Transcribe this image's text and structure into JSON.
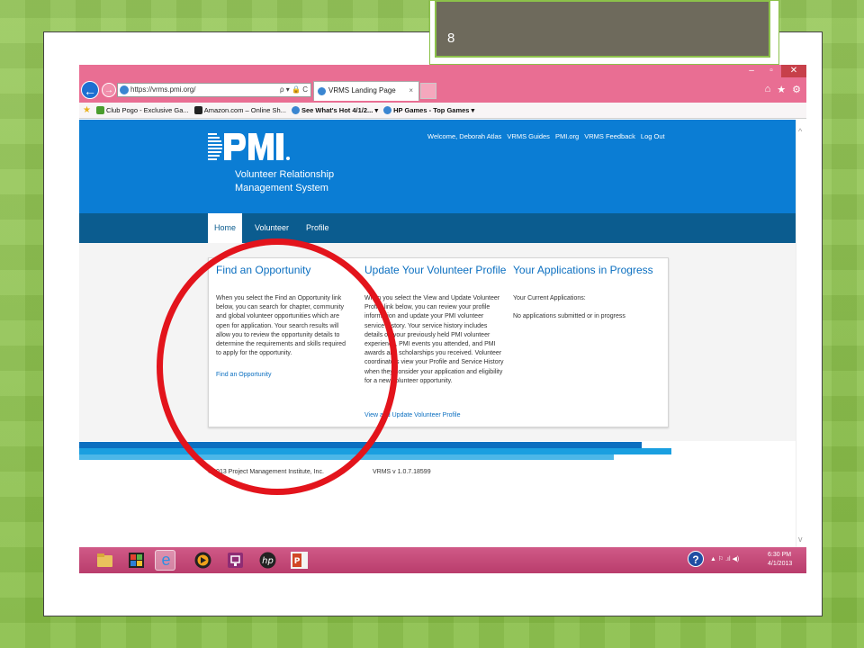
{
  "slide": {
    "number": "8"
  },
  "browser": {
    "url": "https://vrms.pmi.org/",
    "tab_title": "VRMS Landing Page",
    "tab_close": "×",
    "addr_tools": "ρ ▾ 🔒 C",
    "favorites": [
      {
        "label": "Club Pogo - Exclusive Ga...",
        "bold": false,
        "color": "#4a9d2e"
      },
      {
        "label": "Amazon.com – Online Sh...",
        "bold": false,
        "color": "#222222"
      },
      {
        "label": "See What's Hot 4/1/2... ▾",
        "bold": true,
        "color": "#3a86d1"
      },
      {
        "label": "HP Games - Top Games ▾",
        "bold": true,
        "color": "#3a86d1"
      }
    ],
    "window_controls": [
      "–",
      "▫",
      "✕"
    ],
    "nav_icons": [
      "⌂",
      "★",
      "⚙"
    ]
  },
  "header": {
    "logo_text": "PMI",
    "subtitle_line1": "Volunteer Relationship",
    "subtitle_line2": "Management System",
    "top_links": [
      "Welcome, Deborah Atlas",
      "VRMS Guides",
      "PMI.org",
      "VRMS Feedback",
      "Log Out"
    ]
  },
  "menu": {
    "items": [
      "Home",
      "Volunteer",
      "Profile"
    ],
    "active": "Home"
  },
  "panels": {
    "find": {
      "title": "Find an Opportunity",
      "text": "When you select the Find an Opportunity link below, you can search for chapter, community and global volunteer opportunities which are open for application. Your search results will allow you to review the opportunity details to determine the requirements and skills required to apply for the opportunity.",
      "link": "Find an Opportunity"
    },
    "update": {
      "title": "Update Your Volunteer Profile",
      "text": "When you select the View and Update Volunteer Profile link below, you can review your profile information and update your PMI volunteer service history. Your service history includes details on your previously held PMI volunteer experience, PMI events you attended, and PMI awards and scholarships you received. Volunteer coordinators view your Profile and Service History when they consider your application and eligibility for a new volunteer opportunity.",
      "link": "View and Update Volunteer Profile"
    },
    "applications": {
      "title": "Your Applications in Progress",
      "label": "Your Current Applications:",
      "status": "No applications submitted or in progress"
    }
  },
  "footer": {
    "copyright": "©2013 Project Management Institute, Inc.",
    "version": "VRMS v 1.0.7.18599"
  },
  "taskbar": {
    "help": "?",
    "tray": "▲ ⚐ .ıl ◀)",
    "time": "6:30 PM",
    "date": "4/1/2013"
  },
  "colors": {
    "slide_bg": "#8cc14a",
    "header_blue": "#0b7dd4",
    "menu_blue": "#0b5c8f",
    "link_blue": "#0b6fc0",
    "annotation_red": "#e3141c",
    "taskbar": "#c44a78"
  }
}
